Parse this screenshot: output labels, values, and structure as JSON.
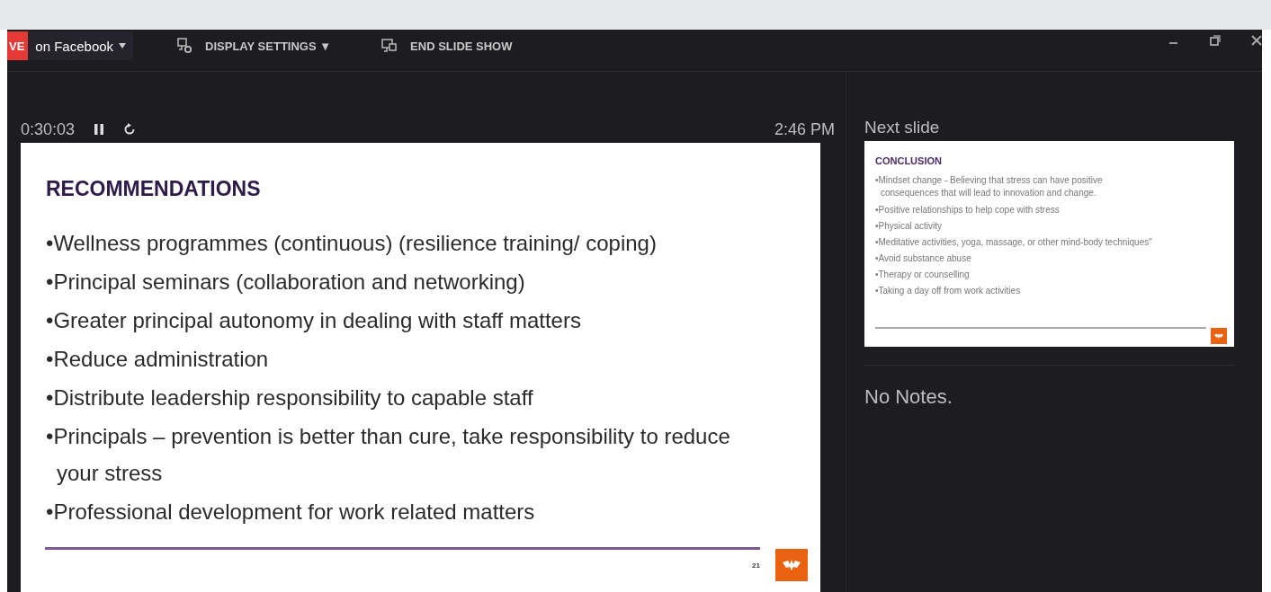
{
  "toolbar": {
    "live_badge": "VE",
    "broadcast": {
      "label": "on Facebook"
    },
    "display_settings": "DISPLAY SETTINGS ▼",
    "end_slide_show": "END SLIDE SHOW"
  },
  "timer": {
    "elapsed": "0:30:03",
    "clock": "2:46 PM"
  },
  "current_slide": {
    "title": "RECOMMENDATIONS",
    "bullets": [
      "•Wellness programmes   (continuous) (resilience training/ coping)",
      "•Principal seminars  (collaboration and networking)",
      "•Greater principal autonomy in dealing with staff matters",
      "•Reduce administration",
      "•Distribute leadership responsibility to capable staff",
      "•Principals – prevention is better than cure, take responsibility to reduce your stress",
      "•Professional development for work related matters"
    ],
    "number": "21"
  },
  "next_slide": {
    "heading": "Next slide",
    "title": "CONCLUSION",
    "bullets": [
      "•Mindset change - Believing that stress can have positive consequences that will lead to innovation and change.",
      "•Positive relationships to help cope with stress",
      "•Physical activity",
      "•Meditative activities, yoga, massage, or other mind-body techniques\"",
      "•Avoid substance abuse",
      "•Therapy or counselling",
      "•Taking a day off from work activities"
    ]
  },
  "notes": "No Notes."
}
